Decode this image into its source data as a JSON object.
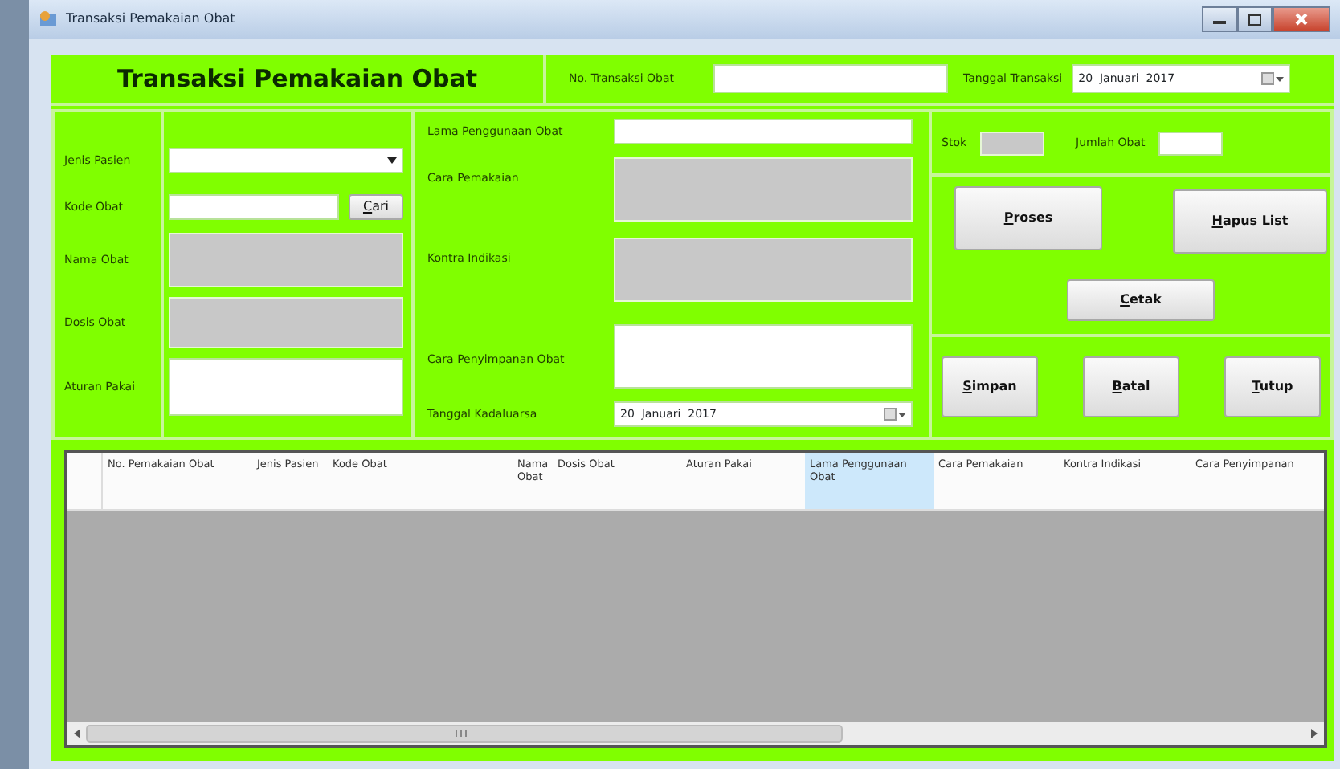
{
  "window": {
    "title": "Transaksi Pemakaian Obat"
  },
  "header": {
    "title": "Transaksi Pemakaian Obat",
    "fields": [
      {
        "label": "No. Transaksi Obat",
        "kind": "text",
        "disabled": false
      },
      {
        "label": "Tanggal Transaksi",
        "kind": "date",
        "value": "20  Januari  2017",
        "disabled": false
      }
    ]
  },
  "left_fields": [
    {
      "label": "Jenis Pasien",
      "kind": "combo",
      "disabled": false
    },
    {
      "label": "Kode Obat",
      "kind": "search",
      "disabled": false,
      "button": {
        "label": "Cari",
        "mnemonic": true
      }
    },
    {
      "label": "Nama Obat",
      "kind": "multiline",
      "disabled": true
    },
    {
      "label": "Dosis Obat",
      "kind": "multiline",
      "disabled": true
    },
    {
      "label": "Aturan Pakai",
      "kind": "multiline",
      "disabled": false
    }
  ],
  "middle_fields": [
    {
      "label": "Lama Penggunaan Obat",
      "kind": "text",
      "disabled": false
    },
    {
      "label": "Cara Pemakaian",
      "kind": "multiline",
      "disabled": true
    },
    {
      "label": "Kontra Indikasi",
      "kind": "multiline",
      "disabled": true
    },
    {
      "label": "Cara Penyimpanan Obat",
      "kind": "multiline",
      "disabled": false
    },
    {
      "label": "Tanggal Kadaluarsa",
      "kind": "date",
      "value": "20  Januari  2017",
      "disabled": false
    }
  ],
  "stock": [
    {
      "label": "Stok",
      "disabled": true
    },
    {
      "label": "Jumlah Obat",
      "disabled": false
    }
  ],
  "action_buttons": [
    {
      "label": "Proses",
      "mnemonic": true
    },
    {
      "label": "Hapus List",
      "mnemonic": true
    },
    {
      "label": "Cetak",
      "mnemonic": true
    }
  ],
  "bottom_buttons": [
    {
      "label": "Simpan",
      "mnemonic": true
    },
    {
      "label": "Batal",
      "mnemonic": true
    },
    {
      "label": "Tutup",
      "mnemonic": true
    }
  ],
  "table": {
    "columns": [
      {
        "label": "No. Pemakaian Obat",
        "selected": false
      },
      {
        "label": "Jenis Pasien",
        "selected": false
      },
      {
        "label": "Kode Obat",
        "selected": false
      },
      {
        "label": "Nama Obat",
        "selected": false
      },
      {
        "label": "Dosis Obat",
        "selected": false
      },
      {
        "label": "Aturan Pakai",
        "selected": false
      },
      {
        "label": "Lama Penggunaan Obat",
        "selected": true
      },
      {
        "label": "Cara Pemakaian",
        "selected": false
      },
      {
        "label": "Kontra Indikasi",
        "selected": false
      },
      {
        "label": "Cara Penyimpanan",
        "selected": false
      }
    ]
  }
}
